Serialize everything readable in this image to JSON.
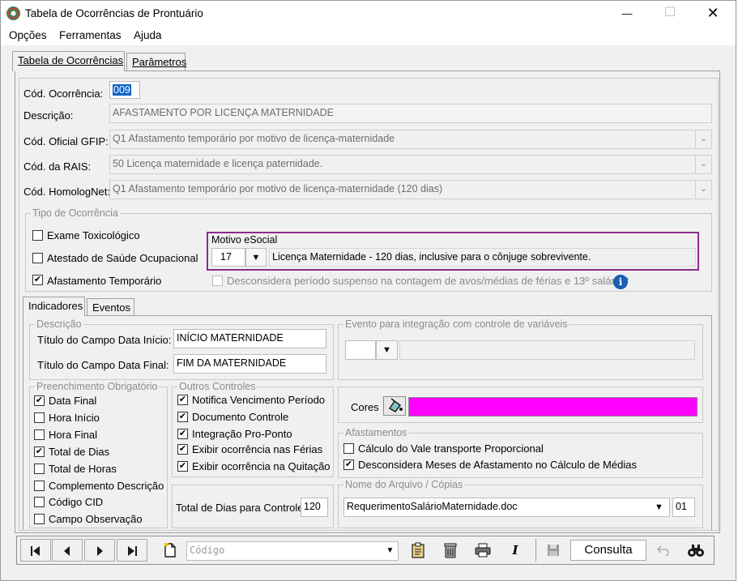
{
  "window": {
    "title": "Tabela de Ocorrências de Prontuário",
    "minimize_glyph": "—",
    "maximize_glyph": "☐",
    "close_glyph": "✕"
  },
  "menu": {
    "opcoes": "Opções",
    "ferramentas": "Ferramentas",
    "ajuda": "Ajuda"
  },
  "tabs": {
    "tabela": "Tabela de Ocorrências",
    "parametros": "Parâmetros"
  },
  "form": {
    "cod_ocorrencia_label": "Cód. Ocorrência:",
    "cod_ocorrencia_value": "009",
    "descricao_label": "Descrição:",
    "descricao_value": "AFASTAMENTO POR LICENÇA MATERNIDADE",
    "gfip_label": "Cód. Oficial GFIP:",
    "gfip_value": "Q1 Afastamento temporário por motivo de licença-maternidade",
    "rais_label": "Cód. da RAIS:",
    "rais_value": "50 Licença maternidade e licença paternidade.",
    "homolognet_label": "Cód. HomologNet:",
    "homolognet_value": "Q1  Afastamento temporário por motivo de licença-maternidade (120 dias)"
  },
  "tipo_ocorrencia": {
    "title": "Tipo de Ocorrência",
    "exame_toxicologico": "Exame Toxicológico",
    "atestado_saude": "Atestado de Saúde Ocupacional",
    "afastamento_temporario": "Afastamento Temporário",
    "check_mark": "✔",
    "motivo_title": "Motivo eSocial",
    "motivo_code": "17",
    "motivo_desc": "Licença Maternidade - 120 dias, inclusive para o cônjuge sobrevivente.",
    "desconsidera_periodo": "Desconsidera período suspenso na contagem de avos/médias de férias e 13º salário?",
    "info_glyph": "i"
  },
  "subtabs": {
    "indicadores": "Indicadores",
    "eventos": "Eventos"
  },
  "descricao_group": {
    "title": "Descrição",
    "data_inicio_label": "Título do Campo Data Início:",
    "data_inicio_value": "INÍCIO MATERNIDADE",
    "data_final_label": "Título do Campo Data Final:",
    "data_final_value": "FIM DA MATERNIDADE"
  },
  "evento_group": {
    "title": "Evento para integração com controle de variáveis"
  },
  "preenchimento": {
    "title": "Preenchimento Obrigatório",
    "items": [
      "Data Final",
      "Hora Início",
      "Hora Final",
      "Total de Dias",
      "Total de Horas",
      "Complemento Descrição",
      "Código CID",
      "Campo Observação"
    ],
    "checked": [
      "✔",
      "",
      "",
      "✔",
      "",
      "",
      "",
      ""
    ]
  },
  "outros": {
    "title": "Outros Controles",
    "items": [
      "Notifica Vencimento Período",
      "Documento Controle",
      "Integração Pro-Ponto",
      "Exibir ocorrência nas Férias",
      "Exibir ocorrência na Quitação"
    ],
    "checked": [
      "✔",
      "✔",
      "✔",
      "✔",
      "✔"
    ]
  },
  "total_dias": {
    "label": "Total de Dias para Controle:",
    "value": "120"
  },
  "cores": {
    "label": "Cores",
    "color": "#ff00ff"
  },
  "afastamentos": {
    "title": "Afastamentos",
    "vale_transporte": "Cálculo do Vale transporte Proporcional",
    "desconsidera_meses": "Desconsidera Meses de Afastamento no Cálculo de Médias"
  },
  "arquivo": {
    "title": "Nome do Arquivo / Cópias",
    "file": "RequerimentoSalárioMaternidade.doc",
    "copias": "01"
  },
  "toolbar": {
    "first": "⏮",
    "prev": "◀",
    "next": "▶",
    "last": "⏭",
    "codigo_placeholder": "Código",
    "italic": "I",
    "consulta": "Consulta"
  },
  "colors": {
    "motivo_border": "#8b2a8f",
    "highlight": "#0a64c8",
    "info": "#1a5fb4",
    "cor_preview": "#ff00ff"
  }
}
